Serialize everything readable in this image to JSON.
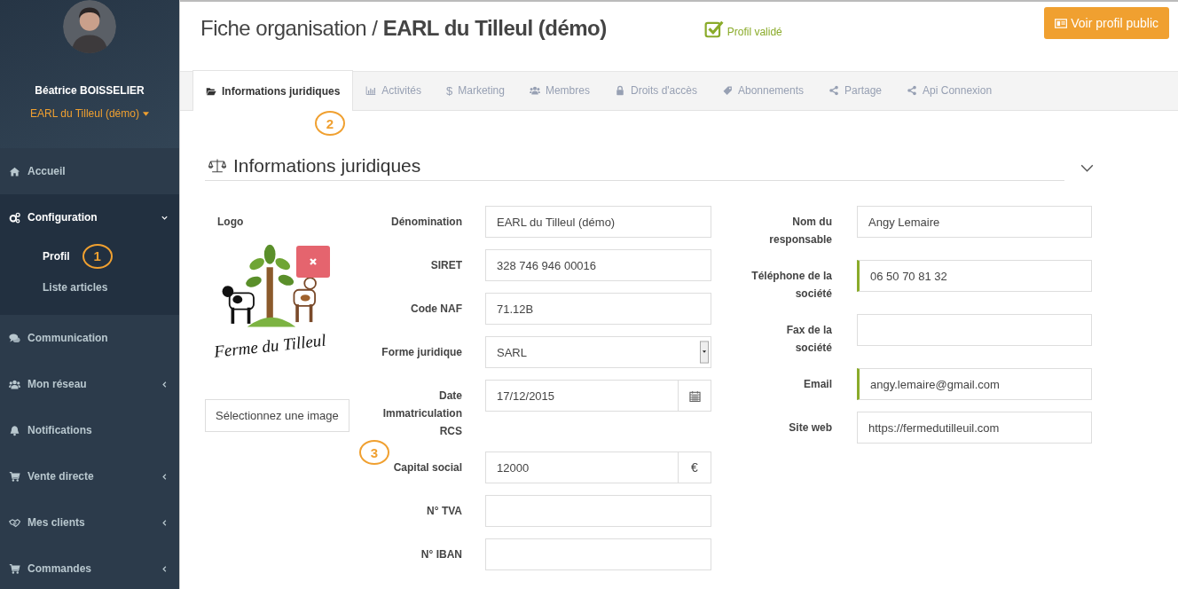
{
  "user": {
    "name": "Béatrice BOISSELIER",
    "organisation": "EARL du Tilleul (démo)"
  },
  "sidebar": {
    "items": [
      {
        "label": "Accueil",
        "selected": false,
        "expandable": false
      },
      {
        "label": "Configuration",
        "selected": true,
        "expandable": true,
        "expanded": true,
        "children": [
          {
            "label": "Profil",
            "selected": true,
            "callout": "1"
          },
          {
            "label": "Liste articles",
            "selected": false
          }
        ]
      },
      {
        "label": "Communication",
        "selected": false,
        "expandable": false
      },
      {
        "label": "Mon réseau",
        "selected": false,
        "expandable": true,
        "expanded": false
      },
      {
        "label": "Notifications",
        "selected": false,
        "expandable": false
      },
      {
        "label": "Vente directe",
        "selected": false,
        "expandable": true,
        "expanded": false
      },
      {
        "label": "Mes clients",
        "selected": false,
        "expandable": true,
        "expanded": false
      },
      {
        "label": "Commandes",
        "selected": false,
        "expandable": true,
        "expanded": false
      }
    ]
  },
  "header": {
    "title": "Fiche organisation / **EARL du Tilleul (démo)**",
    "status": "Profil validé",
    "public_button": "Voir profil public"
  },
  "tabs": [
    {
      "label": "Informations juridiques",
      "selected": true,
      "callout": "2"
    },
    {
      "label": "Activités",
      "selected": false
    },
    {
      "label": "Marketing",
      "selected": false,
      "glyph": "$"
    },
    {
      "label": "Membres",
      "selected": false
    },
    {
      "label": "Droits d'accès",
      "selected": false
    },
    {
      "label": "Abonnements",
      "selected": false
    },
    {
      "label": "Partage",
      "selected": false
    },
    {
      "label": "Api Connexion",
      "selected": false
    }
  ],
  "section": {
    "title": "Informations juridiques",
    "expanded": true,
    "logo": {
      "label": "Logo",
      "logo_text": "Ferme du Tilleul",
      "select_button": "Sélectionnez une image"
    },
    "left_fields": [
      {
        "label": "Dénomination",
        "kind": "text",
        "value": "EARL du Tilleul (démo)",
        "validated": false
      },
      {
        "label": "SIRET",
        "kind": "text",
        "value": "328 746 946 00016",
        "validated": false
      },
      {
        "label": "Code NAF",
        "kind": "text",
        "value": "71.12B",
        "validated": false
      },
      {
        "label": "Forme juridique",
        "kind": "select",
        "value": "SARL",
        "validated": false
      },
      {
        "label": "Date Immatriculation RCS",
        "kind": "date",
        "value": "17/12/2015",
        "validated": false,
        "callout": "3"
      },
      {
        "label": "Capital social",
        "kind": "addon",
        "value": "12000",
        "addon": "€",
        "validated": false
      },
      {
        "label": "N° TVA",
        "kind": "text",
        "validated": false
      },
      {
        "label": "N° IBAN",
        "kind": "text",
        "validated": false
      }
    ],
    "right_fields": [
      {
        "label": "Nom du responsable",
        "kind": "text",
        "value": "Angy Lemaire",
        "validated": false
      },
      {
        "label": "Téléphone de la société",
        "kind": "text",
        "value": "06 50 70 81 32",
        "validated": true
      },
      {
        "label": "Fax de la société",
        "kind": "text",
        "validated": false
      },
      {
        "label": "Email",
        "kind": "text",
        "value": "angy.lemaire@gmail.com",
        "validated": true
      },
      {
        "label": "Site web",
        "kind": "text",
        "value": "https://fermedutilleuil.com",
        "validated": false
      }
    ]
  }
}
